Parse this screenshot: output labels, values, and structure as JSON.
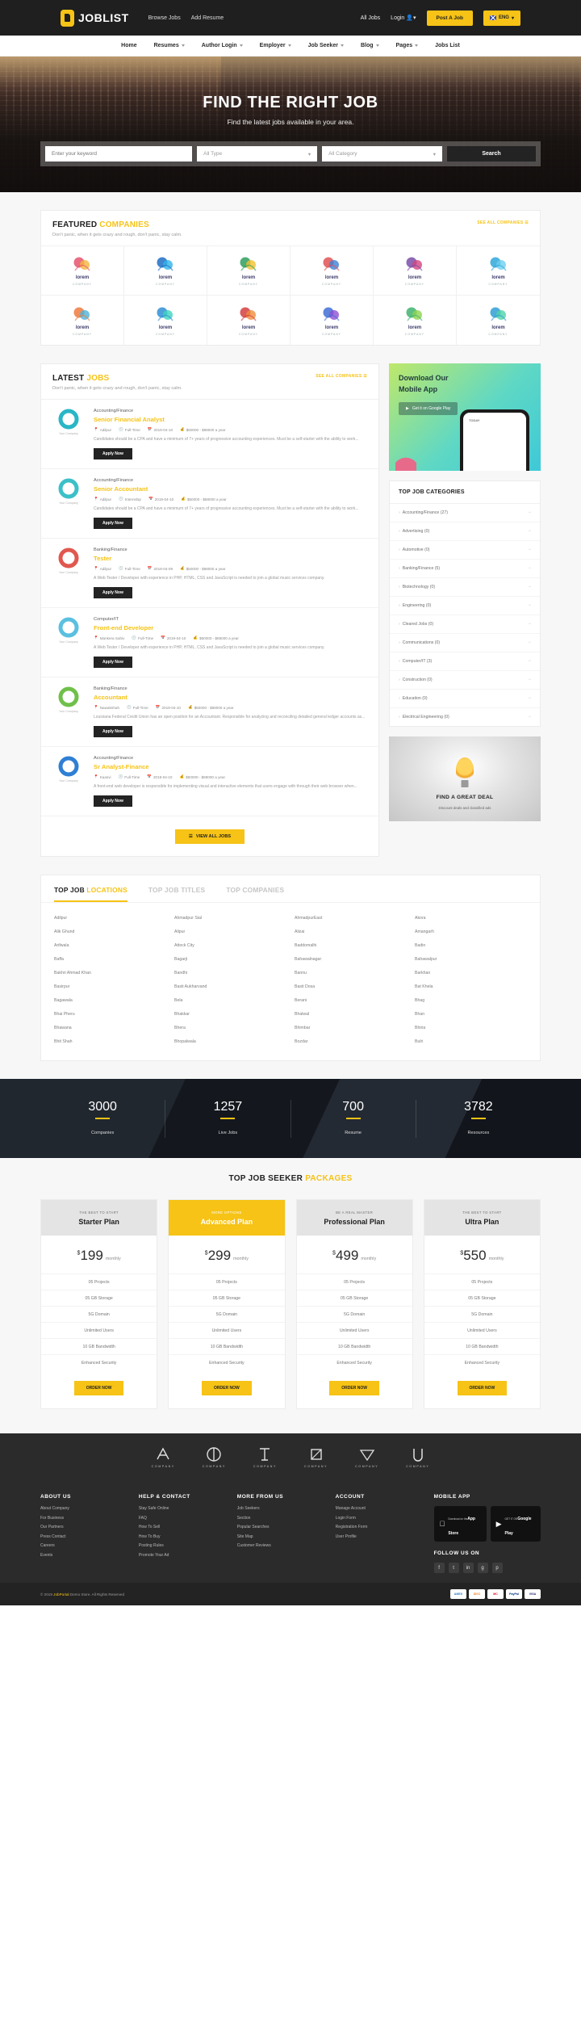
{
  "topbar": {
    "logo_text": "JOBLIST",
    "nav": [
      {
        "label": "Browse Jobs"
      },
      {
        "label": "Add Resume"
      }
    ],
    "all_jobs": "All Jobs",
    "login": "Login",
    "post_job": "Post A Job",
    "lang": "ENG"
  },
  "mainnav": [
    {
      "label": "Home",
      "caret": false
    },
    {
      "label": "Resumes",
      "caret": true
    },
    {
      "label": "Author Login",
      "caret": true
    },
    {
      "label": "Employer",
      "caret": true
    },
    {
      "label": "Job Seeker",
      "caret": true
    },
    {
      "label": "Blog",
      "caret": true
    },
    {
      "label": "Pages",
      "caret": true
    },
    {
      "label": "Jobs List",
      "caret": false
    }
  ],
  "hero": {
    "title": "FIND THE RIGHT JOB",
    "subtitle": "Find the latest jobs available in your area.",
    "keyword_placeholder": "Enter your keyword",
    "type_value": "All Type",
    "category_value": "All Category",
    "search_label": "Search"
  },
  "featured": {
    "title_a": "FEATURED ",
    "title_b": "COMPANIES",
    "desc": "Don't panic, when it gets crazy and rough, don't panic, stay calm.",
    "link": "SEE ALL COMPANIES",
    "companies": [
      {
        "name": "lorem",
        "sub": "COMPANY",
        "c1": "#e8536f",
        "c2": "#f4b63f"
      },
      {
        "name": "lorem",
        "sub": "COMPANY",
        "c1": "#1f6fc4",
        "c2": "#2fb5e8"
      },
      {
        "name": "lorem",
        "sub": "COMPANY",
        "c1": "#2f9e5e",
        "c2": "#f4c02f"
      },
      {
        "name": "lorem",
        "sub": "COMPANY",
        "c1": "#e05353",
        "c2": "#3f7fd4"
      },
      {
        "name": "lorem",
        "sub": "COMPANY",
        "c1": "#7a4fa8",
        "c2": "#d4457f"
      },
      {
        "name": "lorem",
        "sub": "COMPANY",
        "c1": "#2fa8d8",
        "c2": "#6fd0ef"
      },
      {
        "name": "lorem",
        "sub": "COMPANY",
        "c1": "#f07a3f",
        "c2": "#4fb3d8"
      },
      {
        "name": "lorem",
        "sub": "COMPANY",
        "c1": "#2f8fd4",
        "c2": "#3fd4c0"
      },
      {
        "name": "lorem",
        "sub": "COMPANY",
        "c1": "#d43f3f",
        "c2": "#f08f3f"
      },
      {
        "name": "lorem",
        "sub": "COMPANY",
        "c1": "#3f6fd4",
        "c2": "#8f4fd4"
      },
      {
        "name": "lorem",
        "sub": "COMPANY",
        "c1": "#3fb36f",
        "c2": "#8fd44f"
      },
      {
        "name": "lorem",
        "sub": "COMPANY",
        "c1": "#2f9fd4",
        "c2": "#4fd4a8"
      }
    ]
  },
  "latest": {
    "title_a": "LATEST ",
    "title_b": "JOBS",
    "desc": "Don't panic, when it gets crazy and rough, don't panic, stay calm.",
    "link": "SEE ALL COMPANIES",
    "apply_label": "Apply Now",
    "more_label": "VIEW ALL JOBS",
    "company_label": "Your Company",
    "jobs": [
      {
        "category": "Accounting/Finance",
        "title": "Senior Financial Analyst",
        "location": "Adilpur",
        "type": "Full-Time",
        "date": "2019-04-10",
        "salary": "$50000 - $88000 a year",
        "desc": "Candidates should be a CPA and have a minimum of 7+ years of progressive accounting experiences. Must be a self-starter with the ability to work...",
        "logo": "#29b6c6"
      },
      {
        "category": "Accounting/Finance",
        "title": "Senior Accountant",
        "location": "Adilpur",
        "type": "Internship",
        "date": "2019-04-10",
        "salary": "$50000 - $88000 a year",
        "desc": "Candidates should be a CPA and have a minimum of 7+ years of progressive accounting experiences. Must be a self-starter with the ability to work...",
        "logo": "#3cc0c8"
      },
      {
        "category": "Banking/Finance",
        "title": "Tester",
        "location": "Adilpur",
        "type": "Full-Time",
        "date": "2019-04-09",
        "salary": "$50000 - $88000 a year",
        "desc": "A Web Tester / Developer with experience in PHP, HTML, CSS and JavaScript is needed to join a global music services company.",
        "logo": "#e0584f"
      },
      {
        "category": "Computer/IT",
        "title": "Front-end Developer",
        "location": "Mankera Sahiv",
        "type": "Full-Time",
        "date": "2019-04-10",
        "salary": "$50000 - $88000 a year",
        "desc": "A Web Tester / Developer with experience in PHP, HTML, CSS and JavaScript is needed to join a global music services company.",
        "logo": "#5bc0e0"
      },
      {
        "category": "Banking/Finance",
        "title": "Accountant",
        "location": "Nawabshah",
        "type": "Full-Time",
        "date": "2019-04-10",
        "salary": "$50000 - $88000 a year",
        "desc": "Louisiana Federal Credit Union has an open position for an Accountant. Responsible for analyzing and reconciling detailed general ledger accounts as...",
        "logo": "#6fc04a"
      },
      {
        "category": "Accounting/Finance",
        "title": "Sr Analyst-Finance",
        "location": "Kaasvi",
        "type": "Full-Time",
        "date": "2019-04-10",
        "salary": "$50000 - $88000 a year",
        "desc": "A front-end web developer is responsible for implementing visual and interactive elements that users engage with through their web browser when...",
        "logo": "#2f7fd4"
      }
    ]
  },
  "app_widget": {
    "line1": "Download Our",
    "line2": "Mobile App",
    "button": "Get it on Google Play",
    "phone_label": "TODAY"
  },
  "categories_widget": {
    "heading": "TOP JOB CATEGORIES",
    "items": [
      {
        "label": "Accounting/Finance (27)"
      },
      {
        "label": "Advertising (0)"
      },
      {
        "label": "Automotive (0)"
      },
      {
        "label": "Banking/Finance (5)"
      },
      {
        "label": "Biotechnology (0)"
      },
      {
        "label": "Engineering (0)"
      },
      {
        "label": "Cleared Jobs (0)"
      },
      {
        "label": "Communications (0)"
      },
      {
        "label": "Computer/IT (3)"
      },
      {
        "label": "Construction (0)"
      },
      {
        "label": "Education (0)"
      },
      {
        "label": "Electrical Engineering (0)"
      }
    ]
  },
  "deal_widget": {
    "title": "FIND A GREAT DEAL",
    "subtitle": "Discount deals and classified ads"
  },
  "locations": {
    "tabs": [
      {
        "label_a": "TOP JOB ",
        "label_b": "LOCATIONS",
        "active": true
      },
      {
        "label_a": "TOP JOB TITLES",
        "label_b": "",
        "active": false
      },
      {
        "label_a": "TOP COMPANIES",
        "label_b": "",
        "active": false
      }
    ],
    "items": [
      "Adilpur",
      "Ahmadpur Sial",
      "AhmadpurEast",
      "Akora",
      "Alik Ghund",
      "Alipur",
      "Alizai",
      "Amangarh",
      "Arifwala",
      "Attock City",
      "Baddomalhi",
      "Badin",
      "Baffa",
      "Bagarji",
      "Bahawalnagar",
      "Bahawalpur",
      "Bakhri Ahmad Khan",
      "Bandhi",
      "Bannu",
      "Barkhan",
      "Basirpur",
      "Basti Aukharvand",
      "Basti Dosa",
      "Bat Khela",
      "Bagawala",
      "Bela",
      "Berani",
      "Bhag",
      "Bhai Pheru",
      "Bhakkar",
      "Bhalwal",
      "Bhan",
      "Bhawana",
      "Bhera",
      "Bhimbar",
      "Bhiria",
      "Bhit Shah",
      "Bhopalwala",
      "Bozdar",
      "Bulri"
    ]
  },
  "counters": [
    {
      "value": "3000",
      "label": "Companies"
    },
    {
      "value": "1257",
      "label": "Live Jobs"
    },
    {
      "value": "700",
      "label": "Resume"
    },
    {
      "value": "3782",
      "label": "Resources"
    }
  ],
  "packages": {
    "title_a": "TOP JOB SEEKER ",
    "title_b": "PACKAGES",
    "order_label": "ORDER NOW",
    "plans": [
      {
        "tag": "THE BEST TO START",
        "name": "Starter Plan",
        "currency": "$",
        "price": "199",
        "period": "monthly",
        "features": [
          "05 Projects",
          "05 GB Storage",
          "5G Domain",
          "Unlimited Users",
          "10 GB Bandwidth",
          "Enhanced Security"
        ],
        "featured": false
      },
      {
        "tag": "MORE OPTIONS",
        "name": "Advanced Plan",
        "currency": "$",
        "price": "299",
        "period": "monthly",
        "features": [
          "05 Projects",
          "05 GB Storage",
          "5G Domain",
          "Unlimited Users",
          "10 GB Bandwidth",
          "Enhanced Security"
        ],
        "featured": true
      },
      {
        "tag": "BE A REAL MASTER",
        "name": "Professional Plan",
        "currency": "$",
        "price": "499",
        "period": "monthly",
        "features": [
          "05 Projects",
          "05 GB Storage",
          "5G Domain",
          "Unlimited Users",
          "10 GB Bandwidth",
          "Enhanced Security"
        ],
        "featured": false
      },
      {
        "tag": "THE BEST TO START",
        "name": "Ultra Plan",
        "currency": "$",
        "price": "550",
        "period": "monthly",
        "features": [
          "05 Projects",
          "05 GB Storage",
          "5G Domain",
          "Unlimited Users",
          "10 GB Bandwidth",
          "Enhanced Security"
        ],
        "featured": false
      }
    ]
  },
  "brands": [
    {
      "label": "COMPANY"
    },
    {
      "label": "COMPANY"
    },
    {
      "label": "COMPANY"
    },
    {
      "label": "COMPANY"
    },
    {
      "label": "COMPANY"
    },
    {
      "label": "COMPANY"
    }
  ],
  "footer": {
    "columns": [
      {
        "heading": "ABOUT US",
        "links": [
          "About Company",
          "For Business",
          "Our Partners",
          "Press Contact",
          "Careers",
          "Events"
        ]
      },
      {
        "heading": "HELP & CONTACT",
        "links": [
          "Stay Safe Online",
          "FAQ",
          "How To Sell",
          "How To Buy",
          "Posting Rules",
          "Promote Your Ad"
        ]
      },
      {
        "heading": "MORE FROM US",
        "links": [
          "Job Seekers",
          "Section",
          "Popular Searches",
          "Site Map",
          "Customer Reviews"
        ]
      },
      {
        "heading": "ACCOUNT",
        "links": [
          "Manage Account",
          "Login Form",
          "Registration Form",
          "User Profile"
        ]
      }
    ],
    "mobile_app_heading": "MOBILE APP",
    "stores": [
      {
        "small": "Download on the",
        "big": "App Store",
        "icon": "apple-icon"
      },
      {
        "small": "GET IT ON",
        "big": "Google Play",
        "icon": "play-icon"
      }
    ],
    "follow_heading": "FOLLOW US ON",
    "socials": [
      "f",
      "t",
      "in",
      "g",
      "p"
    ],
    "copyright_a": "© 2019 ",
    "copyright_b": "JobPortal",
    "copyright_c": " Demo Store. All Rights Reserved",
    "cards": [
      "AMEX",
      "DISC",
      "MC",
      "PayPal",
      "VISA"
    ]
  }
}
